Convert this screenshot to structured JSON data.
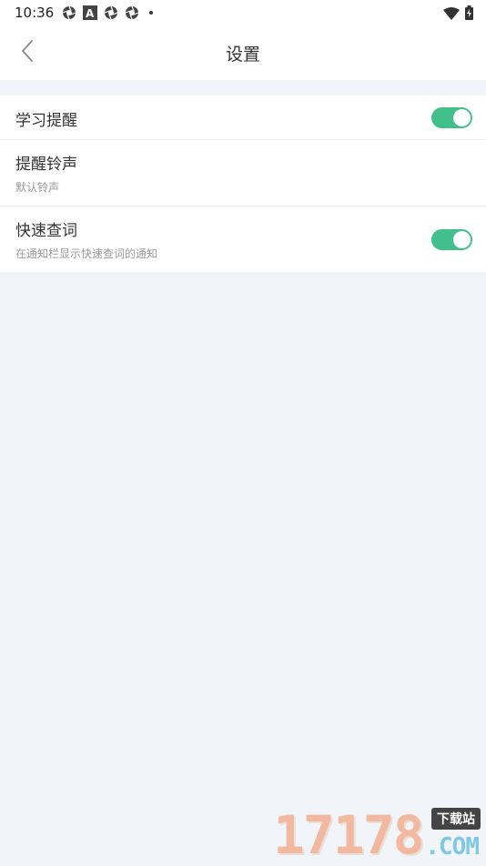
{
  "status_bar": {
    "time": "10:36",
    "icons": [
      "camera-shutter-icon",
      "font-a-icon",
      "camera-shutter-icon",
      "camera-shutter-icon",
      "dot-icon",
      "wifi-icon",
      "battery-charging-icon"
    ]
  },
  "header": {
    "title": "设置",
    "back_icon": "chevron-left-icon"
  },
  "settings": [
    {
      "title": "学习提醒",
      "subtitle": "",
      "has_toggle": true,
      "toggle_on": true
    },
    {
      "title": "提醒铃声",
      "subtitle": "默认铃声",
      "has_toggle": false
    },
    {
      "title": "快速查词",
      "subtitle": "在通知栏显示快速查词的通知",
      "has_toggle": true,
      "toggle_on": true
    }
  ],
  "watermark": {
    "digits": "17178",
    "badge": "下载站",
    "suffix": ".COM"
  },
  "colors": {
    "accent": "#42c08c",
    "background": "#f1f5f9",
    "title_text": "#333333",
    "subtitle_text": "#999999"
  }
}
